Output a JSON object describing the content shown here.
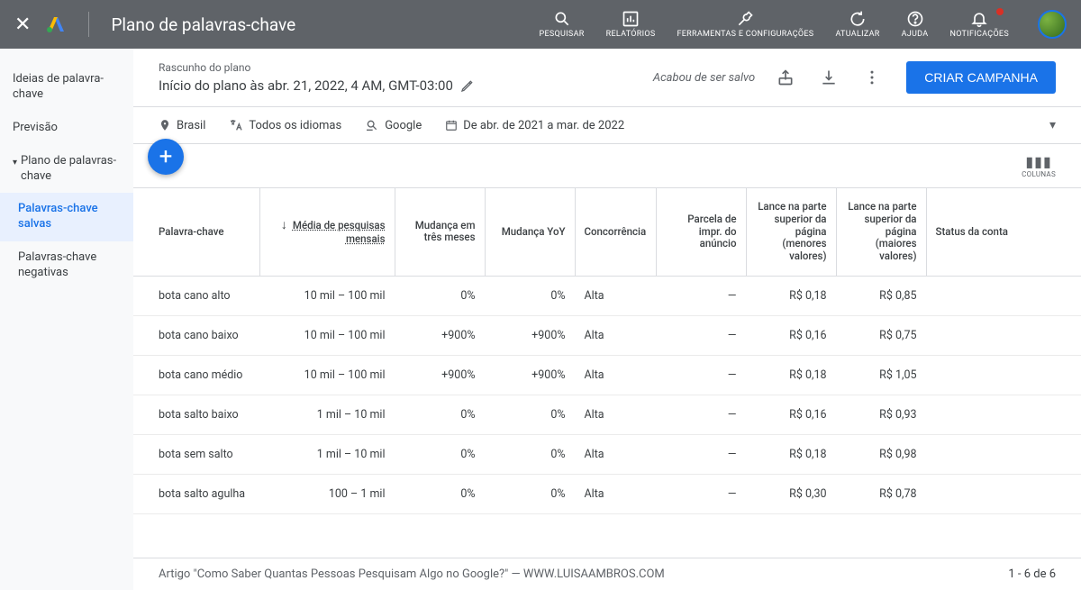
{
  "header": {
    "title": "Plano de palavras-chave",
    "tools": {
      "search": "Pesquisar",
      "reports": "Relatórios",
      "settings": "Ferramentas e configurações",
      "refresh": "Atualizar",
      "help": "Ajuda",
      "notifications": "Notificações"
    }
  },
  "sidebar": {
    "item_ideas": "Ideias de palavra-chave",
    "item_forecast": "Previsão",
    "item_plan": "Plano de palavras-chave",
    "item_saved": "Palavras-chave salvas",
    "item_negative": "Palavras-chave negativas"
  },
  "plan": {
    "sub": "Rascunho do plano",
    "title": "Início do plano às abr. 21, 2022, 4 AM, GMT-03:00",
    "saved": "Acabou de ser salvo",
    "cta": "CRIAR CAMPANHA"
  },
  "filters": {
    "location": "Brasil",
    "language": "Todos os idiomas",
    "network": "Google",
    "daterange": "De abr. de 2021 a mar. de 2022"
  },
  "columns_label": "COLUNAS",
  "table": {
    "headers": {
      "keyword": "Palavra-chave",
      "avg": "Média de pesquisas mensais",
      "change3m": "Mudança em três meses",
      "changeyoy": "Mudança YoY",
      "competition": "Concorrência",
      "impr_share": "Parcela de impr. do anúncio",
      "top_low": "Lance na parte superior da página (menores valores)",
      "top_high": "Lance na parte superior da página (maiores valores)",
      "status": "Status da conta"
    },
    "rows": [
      {
        "kw": "bota cano alto",
        "avg": "10 mil – 100 mil",
        "c3": "0%",
        "cy": "0%",
        "comp": "Alta",
        "share": "—",
        "low": "R$ 0,18",
        "high": "R$ 0,85",
        "status": ""
      },
      {
        "kw": "bota cano baixo",
        "avg": "10 mil – 100 mil",
        "c3": "+900%",
        "cy": "+900%",
        "comp": "Alta",
        "share": "—",
        "low": "R$ 0,16",
        "high": "R$ 0,75",
        "status": ""
      },
      {
        "kw": "bota cano médio",
        "avg": "10 mil – 100 mil",
        "c3": "+900%",
        "cy": "+900%",
        "comp": "Alta",
        "share": "—",
        "low": "R$ 0,18",
        "high": "R$ 1,05",
        "status": ""
      },
      {
        "kw": "bota salto baixo",
        "avg": "1 mil – 10 mil",
        "c3": "0%",
        "cy": "0%",
        "comp": "Alta",
        "share": "—",
        "low": "R$ 0,16",
        "high": "R$ 0,93",
        "status": ""
      },
      {
        "kw": "bota sem salto",
        "avg": "1 mil – 10 mil",
        "c3": "0%",
        "cy": "0%",
        "comp": "Alta",
        "share": "—",
        "low": "R$ 0,18",
        "high": "R$ 0,98",
        "status": ""
      },
      {
        "kw": "bota salto agulha",
        "avg": "100 – 1 mil",
        "c3": "0%",
        "cy": "0%",
        "comp": "Alta",
        "share": "—",
        "low": "R$ 0,30",
        "high": "R$ 0,78",
        "status": ""
      }
    ]
  },
  "footer": {
    "caption_prefix": "Artigo \"Como Saber Quantas Pessoas Pesquisam Algo no Google?\" — ",
    "caption_site": "WWW.LUISAAMBROS.COM",
    "pagination": "1 - 6 de 6"
  }
}
